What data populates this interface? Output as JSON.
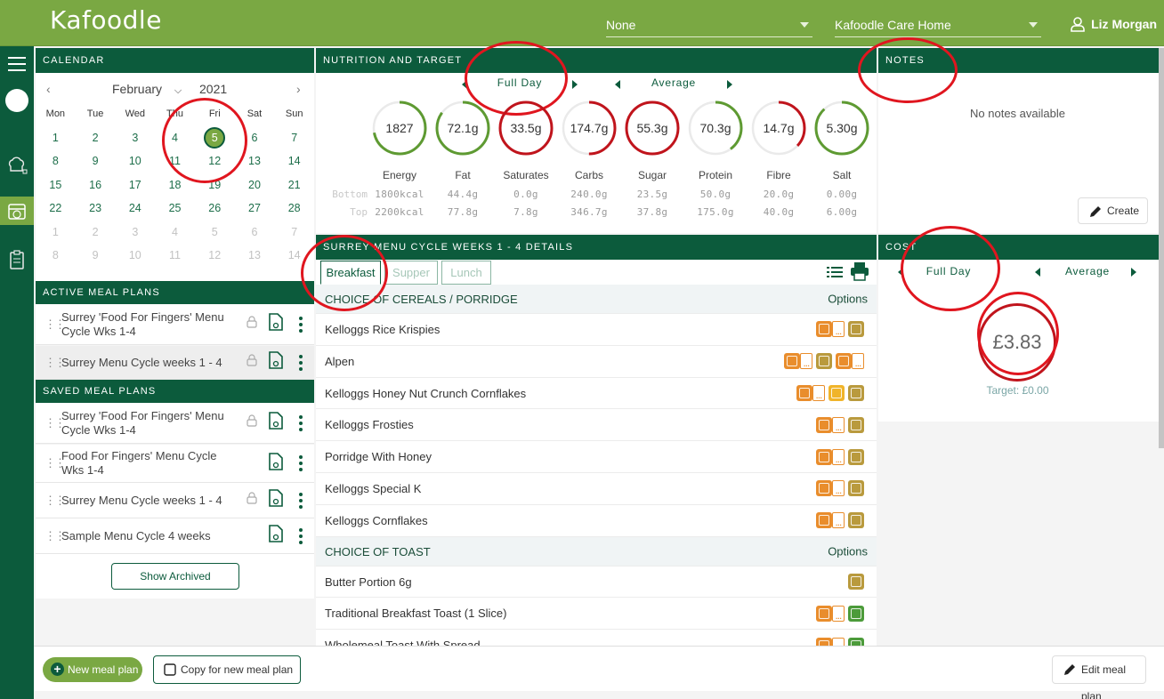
{
  "header": {
    "logo": "Kafoodle",
    "dropdown1": "None",
    "dropdown2": "Kafoodle Care Home",
    "user": "Liz Morgan"
  },
  "calendar": {
    "title": "CALENDAR",
    "month": "February",
    "year": "2021",
    "weekdays": [
      "Mon",
      "Tue",
      "Wed",
      "Thu",
      "Fri",
      "Sat",
      "Sun"
    ],
    "rows": [
      [
        "1",
        "2",
        "3",
        "4",
        "5",
        "6",
        "7"
      ],
      [
        "8",
        "9",
        "10",
        "11",
        "12",
        "13",
        "14"
      ],
      [
        "15",
        "16",
        "17",
        "18",
        "19",
        "20",
        "21"
      ],
      [
        "22",
        "23",
        "24",
        "25",
        "26",
        "27",
        "28"
      ],
      [
        "1",
        "2",
        "3",
        "4",
        "5",
        "6",
        "7"
      ],
      [
        "8",
        "9",
        "10",
        "11",
        "12",
        "13",
        "14"
      ]
    ],
    "selected_day": "5"
  },
  "active_meal_plans": {
    "title": "ACTIVE MEAL PLANS",
    "items": [
      {
        "name": "Surrey 'Food For Fingers' Menu Cycle Wks 1-4"
      },
      {
        "name": "Surrey Menu Cycle weeks 1 - 4"
      }
    ]
  },
  "saved_meal_plans": {
    "title": "SAVED MEAL PLANS",
    "items": [
      {
        "name": "Surrey 'Food For Fingers' Menu Cycle Wks 1-4"
      },
      {
        "name": "Food For Fingers' Menu Cycle Wks 1-4"
      },
      {
        "name": "Surrey Menu Cycle weeks 1 - 4"
      },
      {
        "name": "Sample Menu Cycle 4 weeks"
      }
    ],
    "show_archived": "Show Archived"
  },
  "nutrition": {
    "title": "NUTRITION AND TARGET",
    "period": "Full Day",
    "mode": "Average",
    "bottom_label": "Bottom",
    "top_label": "Top",
    "items": [
      {
        "label": "Energy",
        "value": "1827",
        "bottom": "1800kcal",
        "top": "2200kcal",
        "status": "ok",
        "fill": 0.72
      },
      {
        "label": "Fat",
        "value": "72.1g",
        "bottom": "44.4g",
        "top": "77.8g",
        "status": "ok",
        "fill": 0.85
      },
      {
        "label": "Saturates",
        "value": "33.5g",
        "bottom": "0.0g",
        "top": "7.8g",
        "status": "over",
        "fill": 1.0
      },
      {
        "label": "Carbs",
        "value": "174.7g",
        "bottom": "240.0g",
        "top": "346.7g",
        "status": "over",
        "fill": 0.5
      },
      {
        "label": "Sugar",
        "value": "55.3g",
        "bottom": "23.5g",
        "top": "37.8g",
        "status": "over",
        "fill": 1.0
      },
      {
        "label": "Protein",
        "value": "70.3g",
        "bottom": "50.0g",
        "top": "175.0g",
        "status": "ok",
        "fill": 0.4
      },
      {
        "label": "Fibre",
        "value": "14.7g",
        "bottom": "20.0g",
        "top": "40.0g",
        "status": "over",
        "fill": 0.37
      },
      {
        "label": "Salt",
        "value": "5.30g",
        "bottom": "0.00g",
        "top": "6.00g",
        "status": "ok",
        "fill": 0.88
      }
    ]
  },
  "menu": {
    "title": "SURREY MENU CYCLE WEEKS 1 - 4 DETAILS",
    "tabs": [
      "Breakfast",
      "Supper",
      "Lunch"
    ],
    "rows": [
      {
        "type": "section",
        "name": "CHOICE OF CEREALS / PORRIDGE",
        "options": "Options"
      },
      {
        "type": "item",
        "name": "Kelloggs Rice Krispies",
        "badges": [
          "or",
          "pl",
          "ol"
        ]
      },
      {
        "type": "item",
        "name": "Alpen",
        "badges": [
          "or",
          "pl",
          "ol",
          "or",
          "pl"
        ]
      },
      {
        "type": "item",
        "name": "Kelloggs Honey Nut Crunch Cornflakes",
        "badges": [
          "or",
          "pl",
          "ye",
          "ol"
        ]
      },
      {
        "type": "item",
        "name": "Kelloggs Frosties",
        "badges": [
          "or",
          "pl",
          "ol"
        ]
      },
      {
        "type": "item",
        "name": "Porridge With Honey",
        "badges": [
          "or",
          "pl",
          "ol"
        ]
      },
      {
        "type": "item",
        "name": "Kelloggs Special K",
        "badges": [
          "or",
          "pl",
          "ol"
        ]
      },
      {
        "type": "item",
        "name": "Kelloggs Cornflakes",
        "badges": [
          "or",
          "pl",
          "ol"
        ]
      },
      {
        "type": "section",
        "name": "CHOICE OF TOAST",
        "options": "Options"
      },
      {
        "type": "item",
        "name": "Butter Portion 6g",
        "badges": [
          "ol"
        ]
      },
      {
        "type": "item",
        "name": "Traditional Breakfast Toast (1 Slice)",
        "badges": [
          "or",
          "pl",
          "gr"
        ]
      },
      {
        "type": "item",
        "name": "Wholemeal Toast With Spread",
        "badges": [
          "or",
          "pl",
          "gr"
        ]
      }
    ]
  },
  "notes": {
    "title": "NOTES",
    "empty": "No notes available",
    "create": "Create"
  },
  "cost": {
    "title": "COST",
    "period": "Full Day",
    "mode": "Average",
    "value": "£3.83",
    "target": "Target: £0.00"
  },
  "bottom": {
    "new_plan": "New meal plan",
    "copy_plan": "Copy for new meal plan",
    "edit_plan": "Edit meal plan"
  },
  "colors": {
    "primary": "#0c5b3c",
    "header": "#7aa843",
    "ok": "#5e9a32",
    "over": "#c0141c",
    "annotation": "#e0161f"
  }
}
